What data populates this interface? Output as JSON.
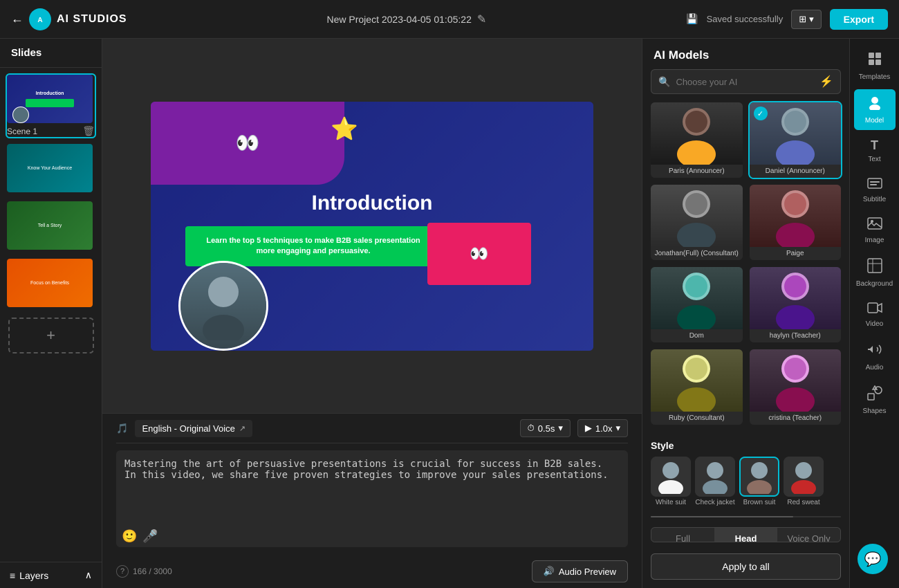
{
  "app": {
    "name": "AI STUDIOS",
    "back_label": "←"
  },
  "topbar": {
    "project_title": "New Project 2023-04-05 01:05:22",
    "edit_icon": "✎",
    "saved_icon": "💾",
    "saved_text": "Saved successfully",
    "view_btn_label": "⊞",
    "export_btn_label": "Export"
  },
  "slides_panel": {
    "header": "Slides",
    "slides": [
      {
        "id": 1,
        "label": "Scene 1",
        "active": true
      },
      {
        "id": 2,
        "label": "",
        "active": false
      },
      {
        "id": 3,
        "label": "",
        "active": false
      },
      {
        "id": 4,
        "label": "",
        "active": false
      }
    ],
    "add_btn_label": "+"
  },
  "layers": {
    "label": "Layers",
    "chevron": "∧"
  },
  "canvas": {
    "slide_title": "Introduction",
    "slide_subtitle": "Learn the top 5 techniques to make B2B sales presentation more engaging and persuasive."
  },
  "voice_bar": {
    "voice_label": "English - Original Voice",
    "voice_icon": "🎵",
    "link_icon": "↗",
    "time_icon": "⏱",
    "time_value": "0.5s",
    "chevron_down": "▾",
    "speed_icon": "▶",
    "speed_value": "1.0x",
    "speed_chevron": "▾"
  },
  "script": {
    "text": "Mastering the art of persuasive presentations is crucial for success in B2B sales. In this video, we share five proven strategies to improve your sales presentations.",
    "char_count": "166",
    "char_limit": "3000",
    "help_icon": "?",
    "audio_btn_label": "Audio Preview",
    "audio_icon": "🔊"
  },
  "ai_models": {
    "header": "AI Models",
    "search_placeholder": "Choose your AI",
    "models": [
      {
        "id": "paris",
        "name": "Paris (Announcer)",
        "selected": false
      },
      {
        "id": "daniel",
        "name": "Daniel (Announcer)",
        "selected": true
      },
      {
        "id": "jonathan",
        "name": "Jonathan(Full) (Consultant)",
        "selected": false
      },
      {
        "id": "paige",
        "name": "Paige",
        "selected": false
      },
      {
        "id": "dom",
        "name": "Dom",
        "selected": false
      },
      {
        "id": "haylyn",
        "name": "haylyn (Teacher)",
        "selected": false
      },
      {
        "id": "ruby",
        "name": "Ruby (Consultant)",
        "selected": false
      },
      {
        "id": "cristina",
        "name": "cristina (Teacher)",
        "selected": false
      }
    ],
    "style_header": "Style",
    "styles": [
      {
        "id": "white_suit",
        "label": "White suit"
      },
      {
        "id": "check_jacket",
        "label": "Check jacket"
      },
      {
        "id": "brown_suit",
        "label": "Brown suit"
      },
      {
        "id": "red_sweat",
        "label": "Red sweat"
      }
    ],
    "position_buttons": [
      {
        "id": "full",
        "label": "Full"
      },
      {
        "id": "head",
        "label": "Head",
        "active": true
      },
      {
        "id": "voice_only",
        "label": "Voice Only"
      }
    ],
    "apply_btn": "Apply to all"
  },
  "toolbar": {
    "items": [
      {
        "id": "templates",
        "icon": "⊞",
        "label": "Templates"
      },
      {
        "id": "model",
        "icon": "👤",
        "label": "Model",
        "active": true
      },
      {
        "id": "text",
        "icon": "T",
        "label": "Text"
      },
      {
        "id": "subtitle",
        "icon": "⊟",
        "label": "Subtitle"
      },
      {
        "id": "image",
        "icon": "🖼",
        "label": "Image"
      },
      {
        "id": "background",
        "icon": "▦",
        "label": "Background"
      },
      {
        "id": "video",
        "icon": "🎬",
        "label": "Video"
      },
      {
        "id": "audio",
        "icon": "🎵",
        "label": "Audio"
      },
      {
        "id": "shapes",
        "icon": "⬟",
        "label": "Shapes"
      }
    ]
  },
  "chat_icon": "💬"
}
